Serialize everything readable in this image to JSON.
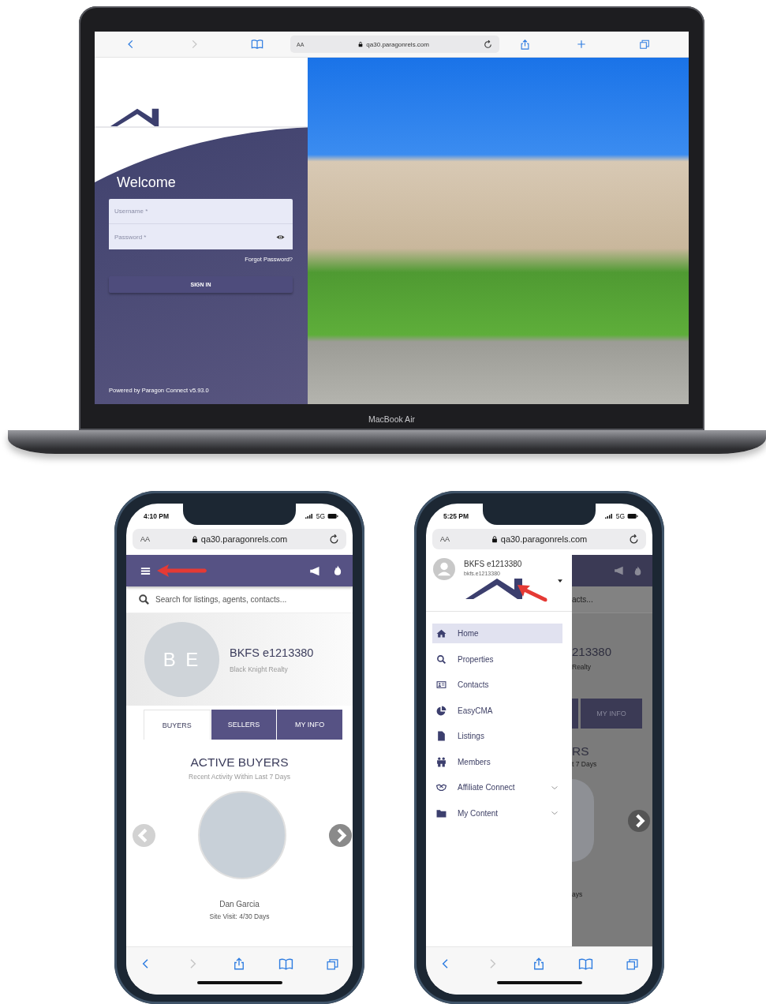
{
  "laptop": {
    "browser": {
      "text_size": "AA",
      "url": "qa30.paragonrels.com",
      "forward_disabled": true
    },
    "login": {
      "title": "Welcome",
      "username_placeholder": "Username *",
      "password_placeholder": "Password *",
      "forgot_link": "Forgot Password?",
      "sign_in_button": "SIGN IN",
      "footer": "Powered by Paragon Connect v5.93.0"
    },
    "label": "MacBook Air"
  },
  "phone_home": {
    "time": "4:10 PM",
    "network": "5G",
    "browser": {
      "text_size": "AA",
      "url": "qa30.paragonrels.com",
      "forward_disabled": true
    },
    "search_placeholder": "Search for listings, agents, contacts...",
    "profile": {
      "initials": "B E",
      "name": "BKFS e1213380",
      "company": "Black Knight Realty"
    },
    "tabs": [
      {
        "label": "BUYERS",
        "selected": true
      },
      {
        "label": "SELLERS",
        "selected": false
      },
      {
        "label": "MY INFO",
        "selected": false
      }
    ],
    "section_title": "ACTIVE BUYERS",
    "section_subtitle": "Recent Activity Within Last 7 Days",
    "carousel": {
      "previous_disabled": true,
      "buyer_name": "Dan Garcia",
      "buyer_detail": "Site Visit: 4/30 Days"
    }
  },
  "phone_menu": {
    "time": "5:25 PM",
    "network": "5G",
    "browser": {
      "text_size": "AA",
      "url": "qa30.paragonrels.com",
      "forward_disabled": true
    },
    "user": {
      "name": "BKFS e1213380",
      "username": "bkfs.e1213380"
    },
    "menu": [
      {
        "label": "Home",
        "selected": true,
        "expandable": false
      },
      {
        "label": "Properties",
        "selected": false,
        "expandable": false
      },
      {
        "label": "Contacts",
        "selected": false,
        "expandable": false
      },
      {
        "label": "EasyCMA",
        "selected": false,
        "expandable": false
      },
      {
        "label": "Listings",
        "selected": false,
        "expandable": false
      },
      {
        "label": "Members",
        "selected": false,
        "expandable": false
      },
      {
        "label": "Affiliate Connect",
        "selected": false,
        "expandable": true
      },
      {
        "label": "My Content",
        "selected": false,
        "expandable": true
      }
    ],
    "behind_drawer": {
      "search_text": "acts...",
      "profile_name": "213380",
      "profile_company": "Realty",
      "tab": "MY INFO",
      "section_title": "RS",
      "section_subtitle": "t 7 Days",
      "buyer_detail": "ays"
    }
  }
}
